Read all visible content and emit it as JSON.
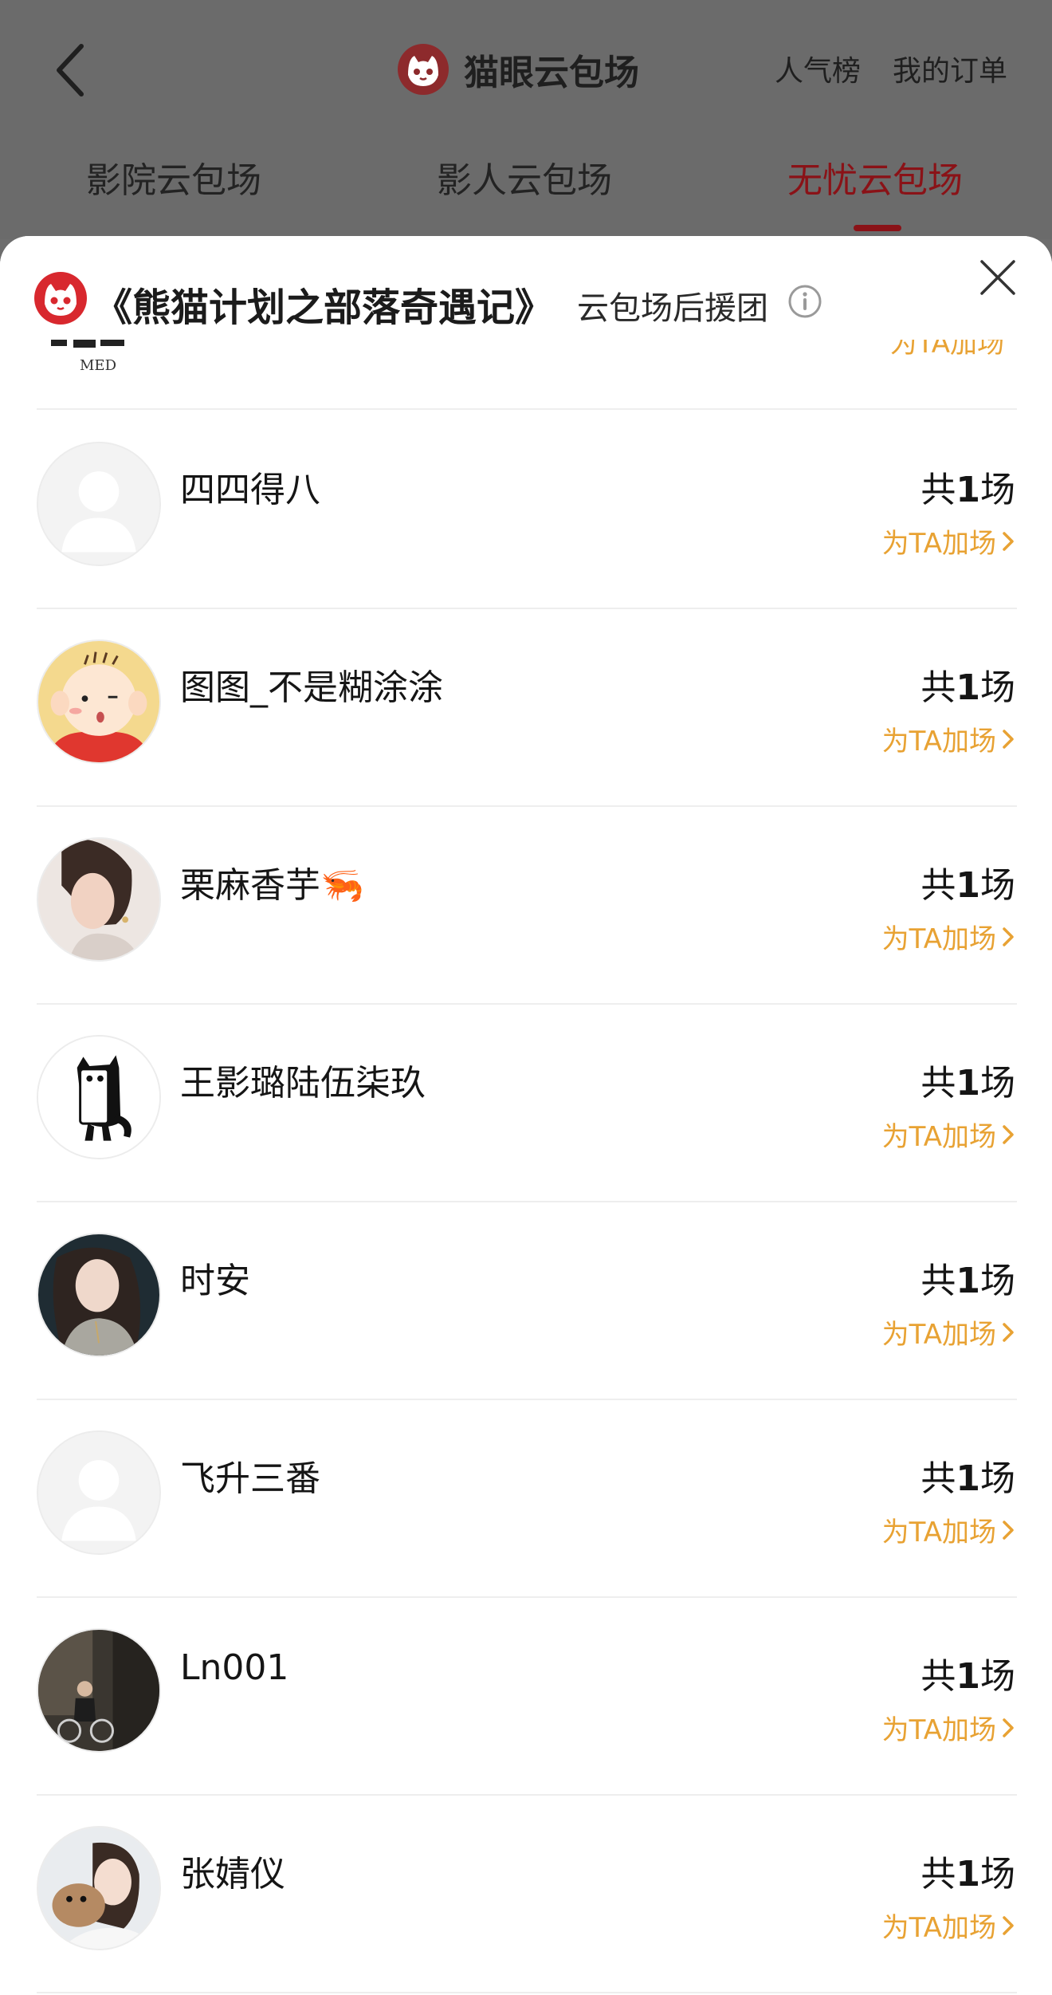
{
  "header": {
    "title": "猫眼云包场",
    "links": {
      "rank": "人气榜",
      "orders": "我的订单"
    },
    "tabs": [
      {
        "label": "影院云包场"
      },
      {
        "label": "影人云包场"
      },
      {
        "label": "无忧云包场",
        "active": true
      }
    ]
  },
  "sheet": {
    "title": "《熊猫计划之部落奇遇记》",
    "subtitle": "云包场后援团",
    "partial_row": {
      "avatar_text": "MED",
      "action": "为TA加场"
    },
    "supporters": [
      {
        "name": "四四得八",
        "count_prefix": "共",
        "count": "1",
        "count_suffix": "场",
        "action": "为TA加场",
        "avatar": "default-avatar"
      },
      {
        "name": "图图_不是糊涂涂",
        "count_prefix": "共",
        "count": "1",
        "count_suffix": "场",
        "action": "为TA加场",
        "avatar": "cartoon-boy-avatar"
      },
      {
        "name": "栗麻香芋🦐",
        "count_prefix": "共",
        "count": "1",
        "count_suffix": "场",
        "action": "为TA加场",
        "avatar": "photo-avatar"
      },
      {
        "name": "王影璐陆伍柒玖",
        "count_prefix": "共",
        "count": "1",
        "count_suffix": "场",
        "action": "为TA加场",
        "avatar": "cat-doodle-avatar"
      },
      {
        "name": "时安",
        "count_prefix": "共",
        "count": "1",
        "count_suffix": "场",
        "action": "为TA加场",
        "avatar": "photo-avatar"
      },
      {
        "name": "飞升三番",
        "count_prefix": "共",
        "count": "1",
        "count_suffix": "场",
        "action": "为TA加场",
        "avatar": "default-avatar"
      },
      {
        "name": "Ln001",
        "count_prefix": "共",
        "count": "1",
        "count_suffix": "场",
        "action": "为TA加场",
        "avatar": "photo-avatar"
      },
      {
        "name": "张婧仪",
        "count_prefix": "共",
        "count": "1",
        "count_suffix": "场",
        "action": "为TA加场",
        "avatar": "photo-avatar"
      }
    ]
  },
  "colors": {
    "brand_red": "#d8282e",
    "active_tab": "#8a1217",
    "action_orange": "#e8a233",
    "overlay": "#6b6b6b"
  }
}
